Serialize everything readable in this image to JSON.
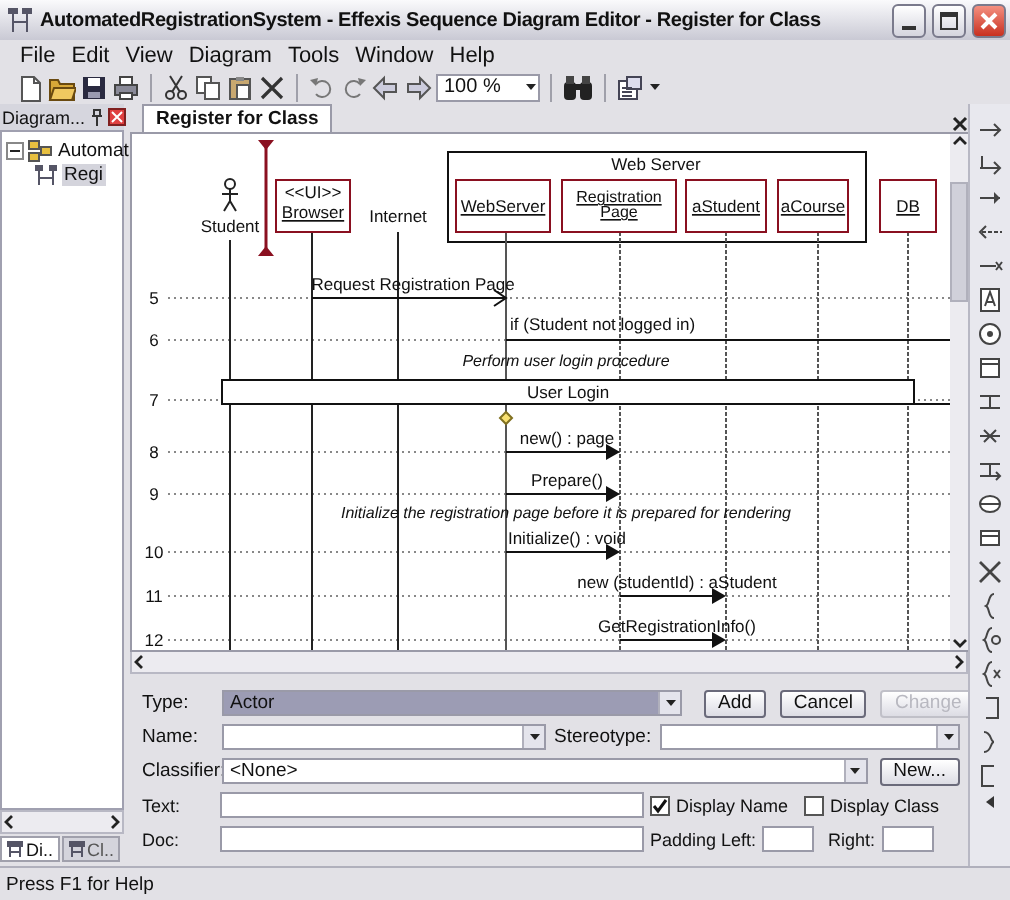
{
  "window": {
    "title": "AutomatedRegistrationSystem - Effexis Sequence Diagram Editor - Register for Class"
  },
  "menu": [
    "File",
    "Edit",
    "View",
    "Diagram",
    "Tools",
    "Window",
    "Help"
  ],
  "toolbar": {
    "zoom": "100 %"
  },
  "explorer": {
    "title": "Diagram...",
    "tree": [
      {
        "label": "Automat",
        "expanded": true,
        "selected": false,
        "children": [
          {
            "label": "Regi",
            "selected": true
          }
        ]
      }
    ],
    "tabs": [
      {
        "label": "Di..",
        "selected": true
      },
      {
        "label": "Cl..",
        "selected": false
      }
    ]
  },
  "document_tabs": [
    {
      "label": "Register for Class",
      "selected": true
    }
  ],
  "diagram": {
    "group": {
      "label": "Web Server"
    },
    "participants": [
      {
        "kind": "actor",
        "name": "Student"
      },
      {
        "kind": "object",
        "stereotype": "<<UI>>",
        "name": "Browser"
      },
      {
        "kind": "label",
        "name": "Internet"
      },
      {
        "kind": "object",
        "name": "WebServer"
      },
      {
        "kind": "object",
        "name": "Registration Page"
      },
      {
        "kind": "object",
        "name": "aStudent"
      },
      {
        "kind": "object",
        "name": "aCourse"
      },
      {
        "kind": "object",
        "name": "DB"
      }
    ],
    "rows": [
      {
        "number": "5",
        "items": [
          {
            "kind": "async",
            "label": "Request Registration Page"
          }
        ]
      },
      {
        "number": "6",
        "items": [
          {
            "kind": "condition",
            "label": "if (Student not logged in)"
          }
        ]
      },
      {
        "number": "7",
        "items": [
          {
            "kind": "comment",
            "label": "Perform user login procedure"
          },
          {
            "kind": "reference",
            "label": "User Login"
          }
        ]
      },
      {
        "number": "8",
        "items": [
          {
            "kind": "call",
            "label": "new() : page"
          }
        ]
      },
      {
        "number": "9",
        "items": [
          {
            "kind": "call",
            "label": "Prepare()"
          }
        ]
      },
      {
        "number": "10",
        "items": [
          {
            "kind": "comment",
            "label": "Initialize the registration page before it is prepared for rendering"
          },
          {
            "kind": "call",
            "label": "Initialize() : void"
          }
        ]
      },
      {
        "number": "11",
        "items": [
          {
            "kind": "call",
            "label": "new (studentId) : aStudent"
          }
        ]
      },
      {
        "number": "12",
        "items": [
          {
            "kind": "call",
            "label": "GetRegistrationInfo()"
          }
        ]
      }
    ]
  },
  "properties": {
    "type": {
      "label": "Type:",
      "value": "Actor",
      "focused": true
    },
    "buttons": [
      {
        "label": "Add",
        "disabled": false
      },
      {
        "label": "Cancel",
        "disabled": false
      },
      {
        "label": "Change",
        "disabled": true
      }
    ],
    "name": {
      "label": "Name:"
    },
    "stereotype": {
      "label": "Stereotype:"
    },
    "classifier": {
      "label": "Classifier:",
      "value": "<None>"
    },
    "new_button": {
      "label": "New..."
    },
    "text": {
      "label": "Text:"
    },
    "display_name": {
      "label": "Display Name",
      "checked": true
    },
    "display_class": {
      "label": "Display Class",
      "checked": false
    },
    "doc": {
      "label": "Doc:"
    },
    "padding_left": {
      "label": "Padding Left:"
    },
    "right": {
      "label": "Right:"
    }
  },
  "status_bar": {
    "text": "Press F1 for Help"
  }
}
